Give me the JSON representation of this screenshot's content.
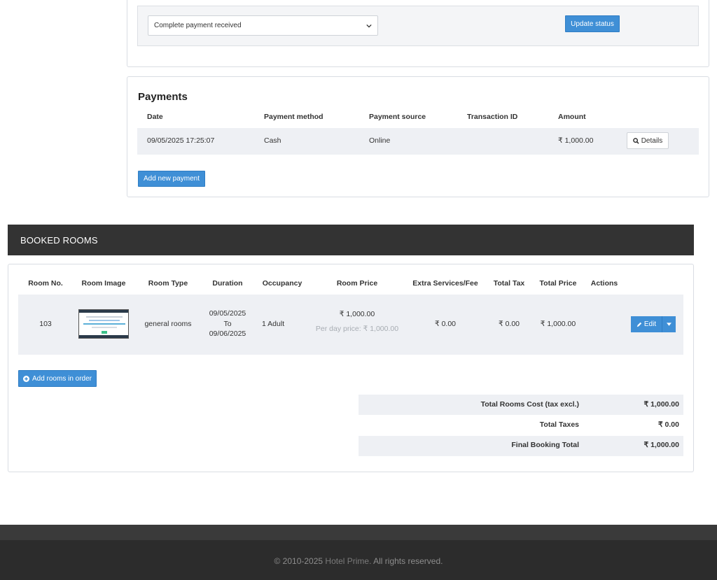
{
  "status_form": {
    "selected_status": "Complete payment received",
    "update_label": "Update status"
  },
  "payments": {
    "title": "Payments",
    "columns": [
      "Date",
      "Payment method",
      "Payment source",
      "Transaction ID",
      "Amount"
    ],
    "rows": [
      {
        "date": "09/05/2025 17:25:07",
        "method": "Cash",
        "source": "Online",
        "transaction_id": "",
        "amount": "₹ 1,000.00",
        "details_label": "Details"
      }
    ],
    "add_label": "Add new payment"
  },
  "booked_rooms": {
    "title": "BOOKED ROOMS",
    "columns": [
      "Room No.",
      "Room Image",
      "Room Type",
      "Duration",
      "Occupancy",
      "Room Price",
      "Extra Services/Fee",
      "Total Tax",
      "Total Price",
      "Actions"
    ],
    "rows": [
      {
        "room_no": "103",
        "room_type": "general rooms",
        "date_from": "09/05/2025",
        "to_label": "To",
        "date_to": "09/06/2025",
        "occupancy": "1 Adult",
        "room_price": "₹ 1,000.00",
        "per_day": "Per day price: ₹ 1,000.00",
        "extra": "₹ 0.00",
        "tax": "₹ 0.00",
        "total": "₹ 1,000.00",
        "edit_label": "Edit"
      }
    ],
    "add_rooms_label": "Add rooms in order",
    "totals": [
      {
        "label": "Total Rooms Cost (tax excl.)",
        "value": "₹ 1,000.00"
      },
      {
        "label": "Total Taxes",
        "value": "₹ 0.00"
      },
      {
        "label": "Final Booking Total",
        "value": "₹ 1,000.00"
      }
    ]
  },
  "footer": {
    "copyright": "© 2010-2025",
    "brand": "Hotel Prime.",
    "rights": "All rights reserved."
  },
  "colors": {
    "accent": "#3f8fd6",
    "header_dark": "#333333",
    "row_shade": "#eef0f4",
    "footer_bg": "#2c2c2c"
  }
}
